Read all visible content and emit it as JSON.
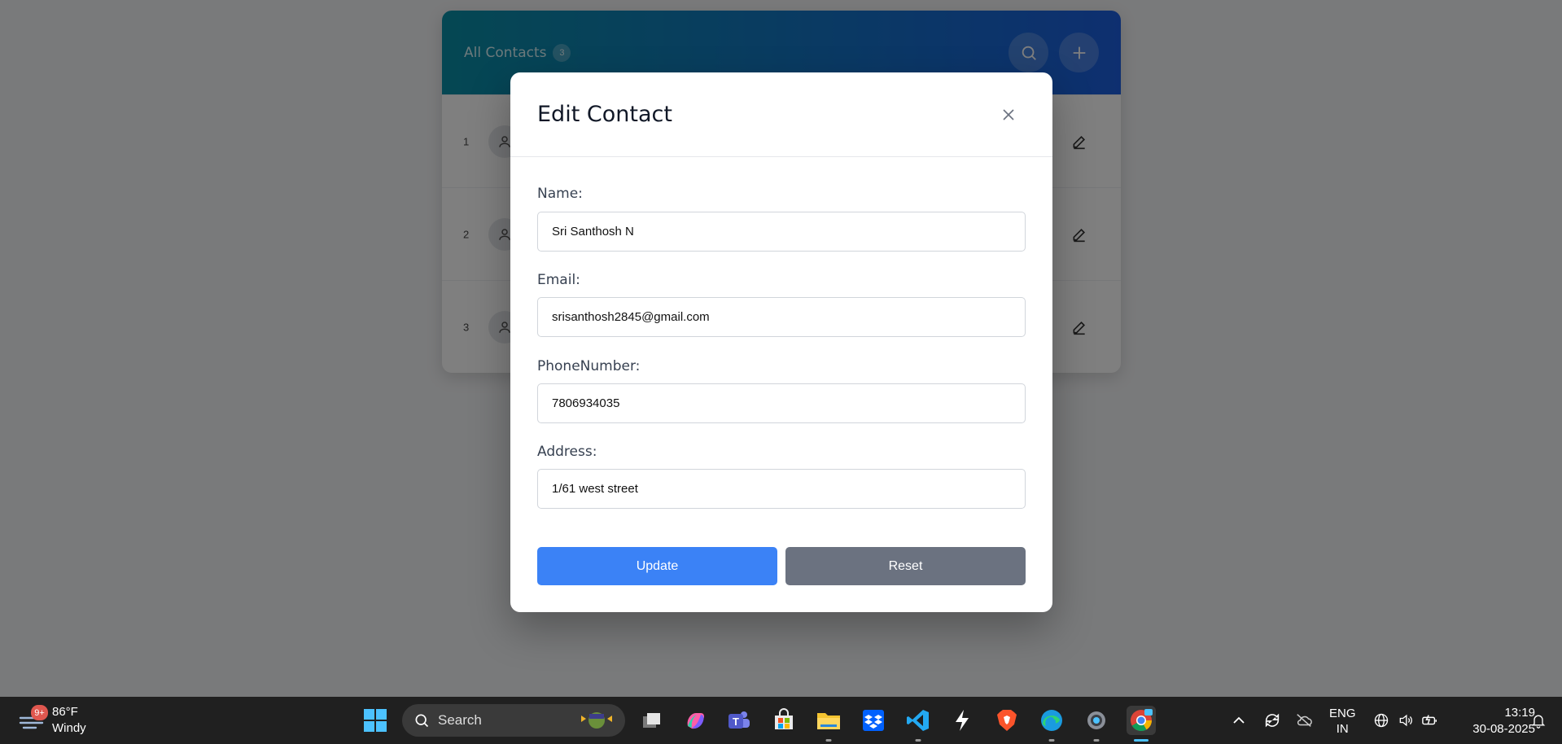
{
  "background_app": {
    "title": "All Contacts",
    "count": "3",
    "rows": [
      {
        "index": "1"
      },
      {
        "index": "2"
      },
      {
        "index": "3"
      }
    ]
  },
  "modal": {
    "title": "Edit Contact",
    "fields": {
      "name": {
        "label": "Name:",
        "value": "Sri Santhosh N"
      },
      "email": {
        "label": "Email:",
        "value": "srisanthosh2845@gmail.com"
      },
      "phone": {
        "label": "PhoneNumber:",
        "value": "7806934035"
      },
      "address": {
        "label": "Address:",
        "value": "1/61 west street"
      }
    },
    "buttons": {
      "update": "Update",
      "reset": "Reset"
    }
  },
  "taskbar": {
    "weather": {
      "temp": "86°F",
      "condition": "Windy",
      "badge": "9+"
    },
    "search_label": "Search",
    "language": {
      "line1": "ENG",
      "line2": "IN"
    },
    "clock": {
      "time": "13:19",
      "date": "30-08-2025"
    },
    "apps": [
      "task-view",
      "copilot",
      "teams",
      "microsoft-store",
      "file-explorer",
      "dropbox",
      "vscode",
      "app-lightning",
      "brave",
      "edge",
      "settings",
      "chrome"
    ]
  },
  "colors": {
    "header_gradient_start": "#0a8fa6",
    "header_gradient_end": "#1c5fe0",
    "update_button": "#3b82f6",
    "reset_button": "#6b7280"
  }
}
